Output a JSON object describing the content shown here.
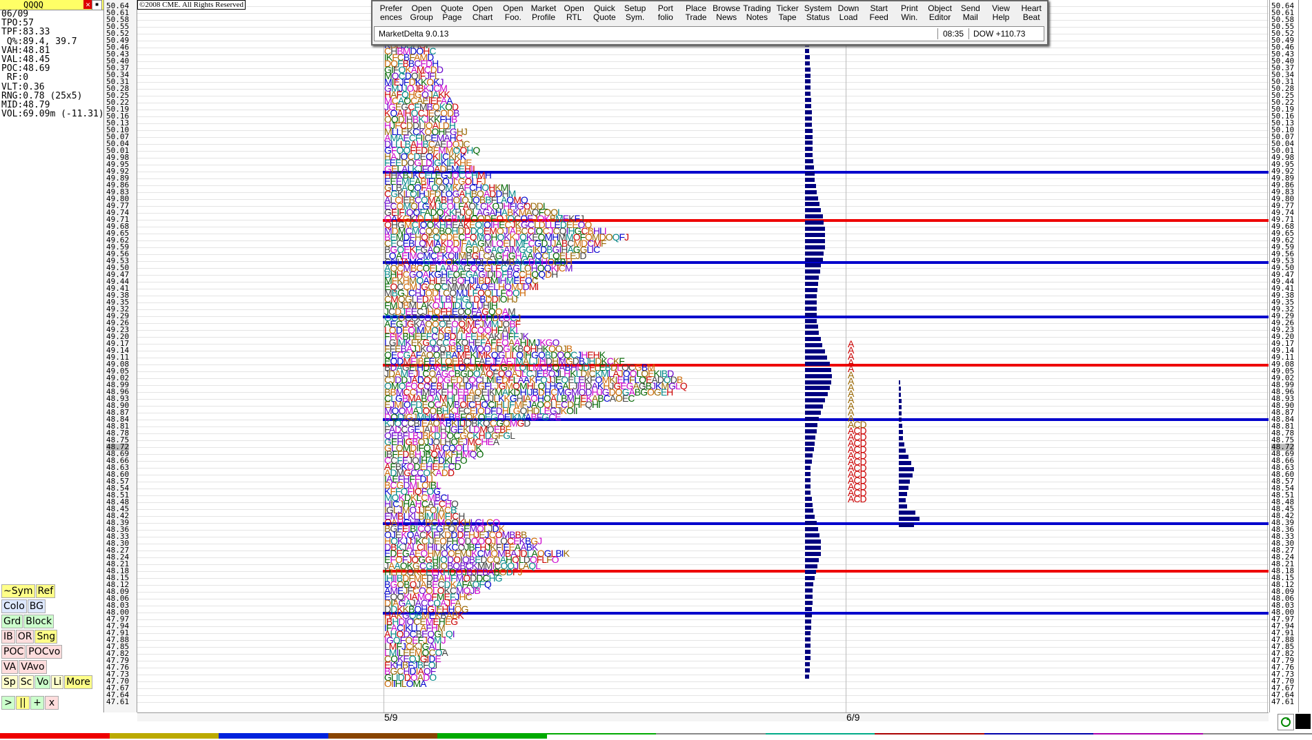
{
  "window": {
    "symbol": "QQQQ",
    "copyright": "©2008 CME. All Rights Reserved"
  },
  "stats": {
    "date": "06/09",
    "tpo": "TPO:57",
    "tpf": "TPF:83.33",
    "q": " Q%:89.4, 39.7",
    "vah": "VAH:48.81",
    "val": "VAL:48.45",
    "poc": "POC:48.69",
    "rf": " RF:0",
    "vlt": "VLT:0.36",
    "rng": "RNG:0.78 (25x5)",
    "mid": "MID:48.79",
    "vol": "VOL:69.09m (-11.31)"
  },
  "side_buttons": {
    "row1": [
      "~Sym",
      "Ref"
    ],
    "row2": [
      "Colo",
      "BG"
    ],
    "row3": [
      "Grd",
      "Block"
    ],
    "row4": [
      "IB",
      "OR",
      "Sng"
    ],
    "row5": [
      "POC",
      "POCvo"
    ],
    "row6": [
      "VA",
      "VAvo"
    ],
    "row7": [
      "Sp",
      "Sc",
      "Vo",
      "Li",
      "More"
    ],
    "row8": [
      ">",
      "||",
      "+",
      "x"
    ]
  },
  "toolbar": {
    "buttons": [
      "Prefer ences",
      "Open Group",
      "Quote Page",
      "Open Chart",
      "Open Foo.",
      "Market Profile",
      "Open RTL",
      "Quick Quote",
      "Setup Sym.",
      "Port folio",
      "Place Trade",
      "Browse News",
      "Trading Notes",
      "Ticker Tape",
      "System Status",
      "Down Load",
      "Start Feed",
      "Print Win.",
      "Object Editor",
      "Send Mail",
      "View Help",
      "Heart Beat"
    ],
    "app_name": "MarketDelta 9.0.13",
    "time": "08:35",
    "dow": "DOW +110.73"
  },
  "axis": {
    "left_ticks": [
      "50.64",
      "50.61",
      "50.58",
      "50.55",
      "50.52",
      "50.49",
      "50.46",
      "50.43",
      "50.40",
      "50.37",
      "50.34",
      "50.31",
      "50.28",
      "50.25",
      "50.22",
      "50.19",
      "50.16",
      "50.13",
      "50.10",
      "50.07",
      "50.04",
      "50.01",
      "49.98",
      "49.95",
      "49.92",
      "49.89",
      "49.86",
      "49.83",
      "49.80",
      "49.77",
      "49.74",
      "49.71",
      "49.68",
      "49.65",
      "49.62",
      "49.59",
      "49.56",
      "49.53",
      "49.50",
      "49.47",
      "49.44",
      "49.41",
      "49.38",
      "49.35",
      "49.32",
      "49.29",
      "49.26",
      "49.23",
      "49.20",
      "49.17",
      "49.14",
      "49.11",
      "49.08",
      "49.05",
      "49.02",
      "48.99",
      "48.96",
      "48.93",
      "48.90",
      "48.87",
      "48.84",
      "48.81",
      "48.78",
      "48.75",
      "48.72",
      "48.69",
      "48.66",
      "48.63",
      "48.60",
      "48.57",
      "48.54",
      "48.51",
      "48.48",
      "48.45",
      "48.42",
      "48.39",
      "48.36",
      "48.33",
      "48.30",
      "48.27",
      "48.24",
      "48.21",
      "48.18",
      "48.15",
      "48.12",
      "48.09",
      "48.06",
      "48.03",
      "48.00",
      "47.97",
      "47.94",
      "47.91",
      "47.88",
      "47.85",
      "47.82",
      "47.79",
      "47.76",
      "47.73",
      "47.70",
      "47.67",
      "47.64",
      "47.61"
    ],
    "highlight_price": "48.72"
  },
  "dates": {
    "d1": "5/9",
    "d2": "6/9"
  },
  "colors": {
    "value_area_line": "#0000cc",
    "poc_line": "#ee0000",
    "volume_bar": "#000080"
  }
}
